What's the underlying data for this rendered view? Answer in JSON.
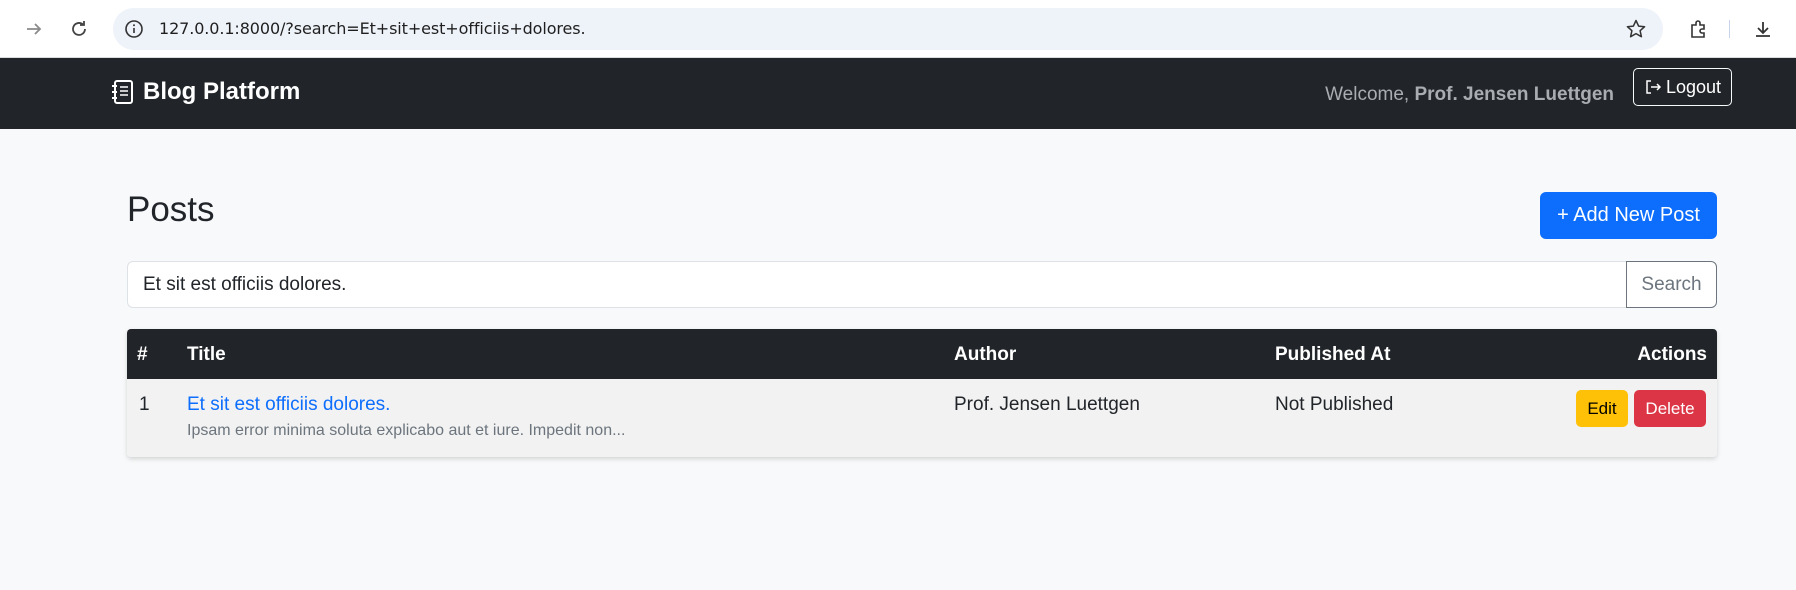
{
  "browser": {
    "url": "127.0.0.1:8000/?search=Et+sit+est+officiis+dolores.",
    "icons": [
      "forward-icon",
      "reload-icon",
      "site-info-icon",
      "bookmark-star-icon",
      "extensions-icon",
      "download-icon"
    ]
  },
  "navbar": {
    "brand": "Blog Platform",
    "brand_icon": "journal-icon",
    "welcome_prefix": "Welcome,",
    "user_name": "Prof. Jensen Luettgen",
    "logout_label": "Logout",
    "logout_icon": "logout-icon"
  },
  "main": {
    "title": "Posts",
    "add_button": "+ Add New Post",
    "search": {
      "value": "Et sit est officiis dolores.",
      "button": "Search"
    },
    "table": {
      "headers": [
        "#",
        "Title",
        "Author",
        "Published At",
        "Actions"
      ],
      "rows": [
        {
          "index": "1",
          "title": "Et sit est officiis dolores.",
          "excerpt": "Ipsam error minima soluta explicabo aut et iure. Impedit non...",
          "author": "Prof. Jensen Luettgen",
          "published_at": "Not Published",
          "edit_label": "Edit",
          "delete_label": "Delete"
        }
      ]
    }
  },
  "colors": {
    "navbar_bg": "#212529",
    "primary": "#0d6efd",
    "warning": "#ffc107",
    "danger": "#dc3545",
    "page_bg": "#f8f9fa"
  }
}
